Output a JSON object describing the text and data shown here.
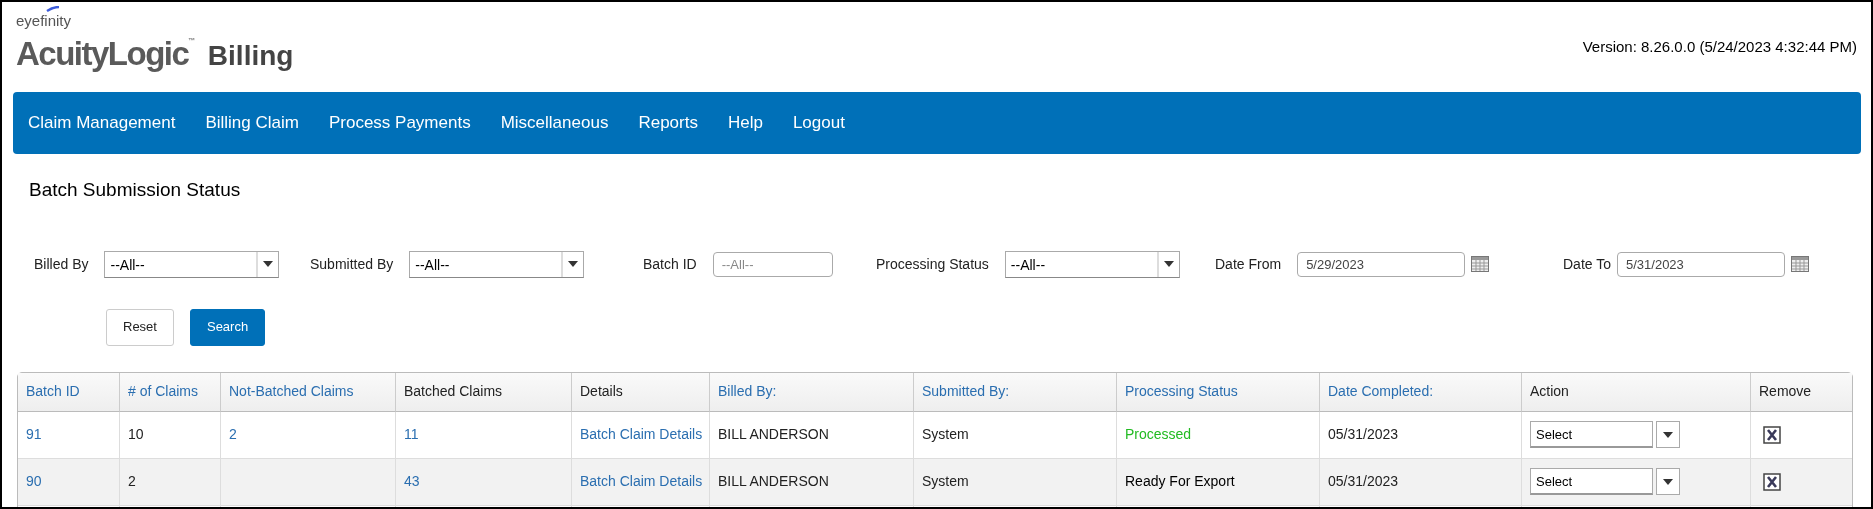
{
  "header": {
    "tagline": "eyefinity",
    "brand": "AcuityLogic",
    "trademark": "™",
    "app": "Billing",
    "version": "Version: 8.26.0.0 (5/24/2023 4:32:44 PM)"
  },
  "nav": [
    "Claim Management",
    "Billing Claim",
    "Process Payments",
    "Miscellaneous",
    "Reports",
    "Help",
    "Logout"
  ],
  "page_title": "Batch Submission Status",
  "filters": [
    {
      "kind": "dropdown",
      "label": "Billed By",
      "value": "--All--"
    },
    {
      "kind": "dropdown",
      "label": "Submitted By",
      "value": "--All--"
    },
    {
      "kind": "text",
      "label": "Batch ID",
      "placeholder": "--All--"
    },
    {
      "kind": "dropdown",
      "label": "Processing Status",
      "value": "--All--"
    },
    {
      "kind": "date",
      "label": "Date From",
      "value": "5/29/2023"
    },
    {
      "kind": "date",
      "label": "Date To",
      "value": "5/31/2023"
    }
  ],
  "buttons": [
    {
      "label": "Reset",
      "primary": false
    },
    {
      "label": "Search",
      "primary": true
    }
  ],
  "table": {
    "columns": [
      {
        "label": "Batch ID",
        "sortable": true
      },
      {
        "label": "# of Claims",
        "sortable": true
      },
      {
        "label": "Not-Batched Claims",
        "sortable": true
      },
      {
        "label": "Batched Claims",
        "sortable": false
      },
      {
        "label": "Details",
        "sortable": false
      },
      {
        "label": "Billed By:",
        "sortable": true
      },
      {
        "label": "Submitted By:",
        "sortable": true
      },
      {
        "label": "Processing Status",
        "sortable": true
      },
      {
        "label": "Date Completed:",
        "sortable": true
      },
      {
        "label": "Action",
        "sortable": false
      },
      {
        "label": "Remove",
        "sortable": false
      }
    ],
    "rows": [
      {
        "batch_id": "91",
        "claims": "10",
        "not_batched": "2",
        "batched": "11",
        "details": "Batch Claim Details",
        "billed_by": "BILL ANDERSON",
        "submitted_by": "System",
        "status": {
          "text": "Processed",
          "color": "#22bb22"
        },
        "date_completed": "05/31/2023",
        "action": "Select"
      },
      {
        "batch_id": "90",
        "claims": "2",
        "batched": "43",
        "details": "Batch Claim Details",
        "billed_by": "BILL ANDERSON",
        "submitted_by": "System",
        "status": {
          "text": "Ready For Export",
          "color": "#000000"
        },
        "date_completed": "05/31/2023",
        "action": "Select"
      }
    ]
  }
}
